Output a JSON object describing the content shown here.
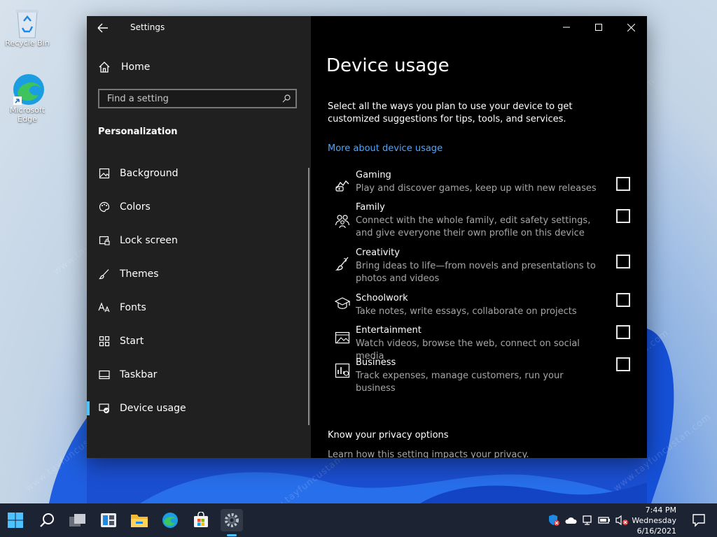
{
  "desktop": {
    "icons": [
      {
        "label": "Recycle Bin",
        "icon": "recycle-bin-icon"
      },
      {
        "label": "Microsoft Edge",
        "icon": "edge-icon"
      }
    ]
  },
  "window": {
    "app_title": "Settings",
    "back": {
      "icon": "back-arrow-icon"
    },
    "caption": {
      "minimize": "minimize-icon",
      "maximize": "maximize-icon",
      "close": "close-icon"
    }
  },
  "sidebar": {
    "home_label": "Home",
    "search_placeholder": "Find a setting",
    "section_header": "Personalization",
    "items": [
      {
        "label": "Background",
        "icon": "picture-icon",
        "active": false
      },
      {
        "label": "Colors",
        "icon": "palette-icon",
        "active": false
      },
      {
        "label": "Lock screen",
        "icon": "lock-screen-icon",
        "active": false
      },
      {
        "label": "Themes",
        "icon": "brush-icon",
        "active": false
      },
      {
        "label": "Fonts",
        "icon": "font-icon",
        "active": false
      },
      {
        "label": "Start",
        "icon": "start-tiles-icon",
        "active": false
      },
      {
        "label": "Taskbar",
        "icon": "taskbar-icon",
        "active": false
      },
      {
        "label": "Device usage",
        "icon": "device-usage-icon",
        "active": true
      }
    ]
  },
  "main": {
    "title": "Device usage",
    "description": "Select all the ways you plan to use your device to get customized suggestions for tips, tools, and services.",
    "more_link": "More about device usage",
    "usage_options": [
      {
        "title": "Gaming",
        "desc": "Play and discover games, keep up with new releases",
        "icon": "gaming-icon",
        "checked": false
      },
      {
        "title": "Family",
        "desc": "Connect with the whole family, edit safety settings, and give everyone their own profile on this device",
        "icon": "family-icon",
        "checked": false
      },
      {
        "title": "Creativity",
        "desc": "Bring ideas to life—from novels and presentations to photos and videos",
        "icon": "creativity-icon",
        "checked": false
      },
      {
        "title": "Schoolwork",
        "desc": "Take notes, write essays, collaborate on projects",
        "icon": "schoolwork-icon",
        "checked": false
      },
      {
        "title": "Entertainment",
        "desc": "Watch videos, browse the web, connect on social media",
        "icon": "entertainment-icon",
        "checked": false
      },
      {
        "title": "Business",
        "desc": "Track expenses, manage customers, run your business",
        "icon": "business-icon",
        "checked": false
      }
    ],
    "privacy_header": "Know your privacy options",
    "privacy_link": "Learn how this setting impacts your privacy."
  },
  "taskbar": {
    "apps": [
      "start-icon",
      "search-icon",
      "task-view-icon",
      "widgets-icon",
      "file-explorer-icon",
      "edge-icon",
      "store-icon",
      "settings-icon"
    ],
    "clock": {
      "time": "7:44 PM",
      "day": "Wednesday",
      "date": "6/16/2021"
    }
  },
  "watermark": "www.tayfuncustan.com",
  "colors": {
    "accent": "#4cc2ff",
    "link": "#4ca6ff",
    "sidebar_bg": "#202020",
    "pane_bg": "#000000"
  }
}
